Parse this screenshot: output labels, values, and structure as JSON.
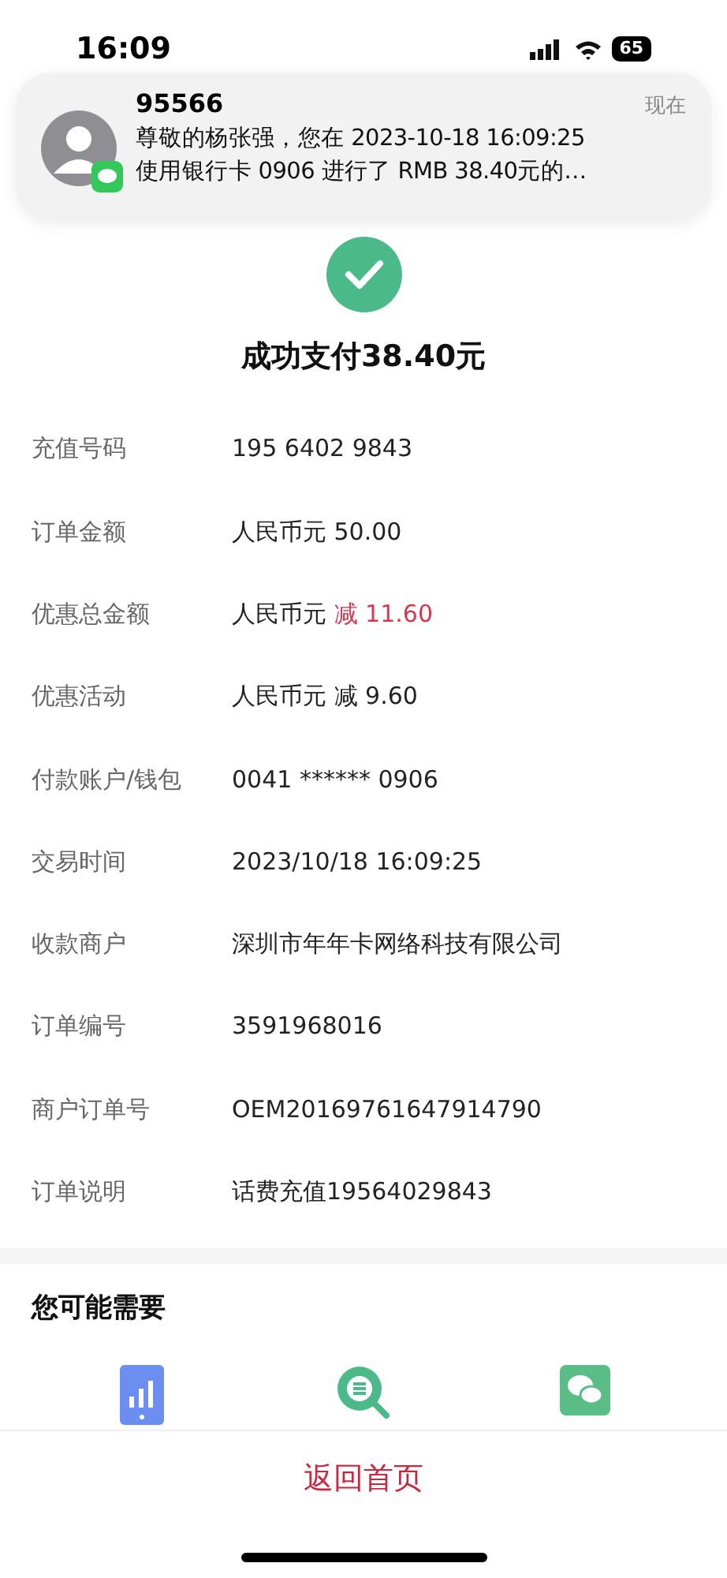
{
  "status_bar": {
    "time": "16:09",
    "battery": "65"
  },
  "notification": {
    "sender": "95566",
    "time": "现在",
    "lines": [
      "尊敬的杨张强，您在 2023-10-18 16:09:25",
      "使用银行卡 0906 进行了 RMB 38.40元的…"
    ]
  },
  "result": {
    "title": "成功支付38.40元"
  },
  "details": [
    {
      "label": "充值号码",
      "value": "195 6402 9843"
    },
    {
      "label": "订单金额",
      "value": "人民币元 50.00"
    },
    {
      "label": "优惠总金额",
      "value": "人民币元",
      "accent": "减 11.60"
    },
    {
      "label": "优惠活动",
      "value": "人民币元 减 9.60"
    },
    {
      "label": "付款账户/钱包",
      "value": "0041 ****** 0906"
    },
    {
      "label": "交易时间",
      "value": "2023/10/18 16:09:25"
    },
    {
      "label": "收款商户",
      "value": "深圳市年年卡网络科技有限公司"
    },
    {
      "label": "订单编号",
      "value": "3591968016"
    },
    {
      "label": "商户订单号",
      "value": "OEM20169761647914790"
    },
    {
      "label": "订单说明",
      "value": "话费充值19564029843"
    }
  ],
  "suggestions": {
    "title": "您可能需要",
    "items": [
      {
        "kind": "phone"
      },
      {
        "kind": "search"
      },
      {
        "kind": "chat"
      }
    ]
  },
  "bottom_bar": {
    "button": "返回首页"
  }
}
